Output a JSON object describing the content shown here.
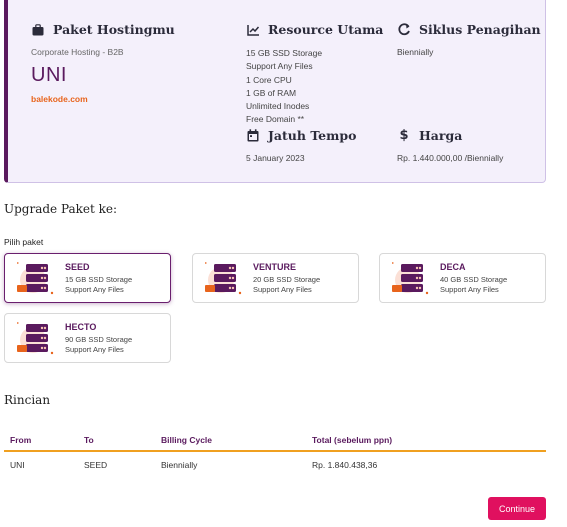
{
  "current": {
    "package_title": "Paket Hostingmu",
    "package_sub": "Corporate Hosting - B2B",
    "plan_name": "UNI",
    "domain": "balekode.com",
    "resource_title": "Resource Utama",
    "resources": [
      "15 GB SSD Storage",
      "Support Any Files",
      "1 Core CPU",
      "1 GB of RAM",
      "Unlimited Inodes",
      "Free Domain **"
    ],
    "billing_title": "Siklus Penagihan",
    "billing_value": "Biennially",
    "due_title": "Jatuh Tempo",
    "due_value": "5 January 2023",
    "price_title": "Harga",
    "price_value": "Rp. 1.440.000,00 /Biennially"
  },
  "upgrade": {
    "heading": "Upgrade Paket ke:",
    "choose_label": "Pilih paket",
    "packages": [
      {
        "name": "SEED",
        "line1": "15 GB SSD Storage",
        "line2": "Support Any Files",
        "selected": true
      },
      {
        "name": "VENTURE",
        "line1": "20 GB SSD Storage",
        "line2": "Support Any Files",
        "selected": false
      },
      {
        "name": "DECA",
        "line1": "40 GB SSD Storage",
        "line2": "Support Any Files",
        "selected": false
      },
      {
        "name": "HECTO",
        "line1": "90 GB SSD Storage",
        "line2": "Support Any Files",
        "selected": false
      }
    ]
  },
  "details": {
    "heading": "Rincian",
    "headers": [
      "From",
      "To",
      "Billing Cycle",
      "Total (sebelum ppn)"
    ],
    "row": [
      "UNI",
      "SEED",
      "Biennially",
      "Rp. 1.840.438,36"
    ]
  },
  "actions": {
    "continue_label": "Continue"
  },
  "colors": {
    "brand": "#5a1a5e",
    "accent": "#e0105f",
    "domain": "#e8641c",
    "divider": "#f0a020"
  }
}
